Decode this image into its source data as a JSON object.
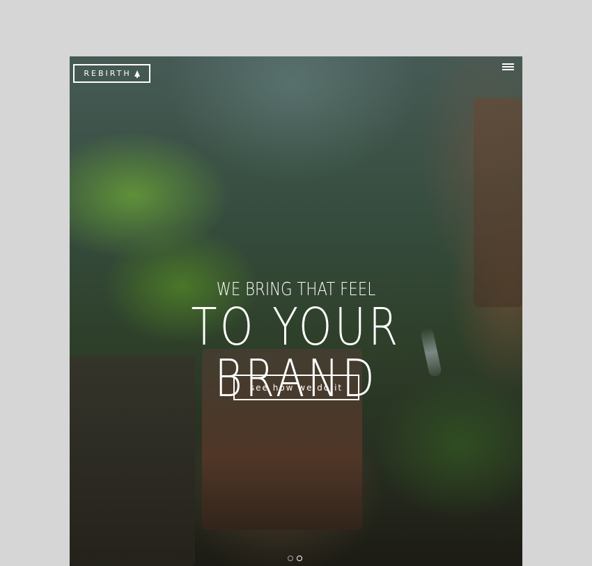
{
  "header": {
    "logo_text": "REBIRTH",
    "logo_icon": "tree-icon",
    "menu_icon": "hamburger-menu-icon"
  },
  "hero": {
    "tagline": "WE BRING THAT FEEL",
    "headline": "TO YOUR BRAND",
    "cta_label": "see how we do it"
  },
  "slider": {
    "slide_count": 2,
    "active_index": 1
  },
  "colors": {
    "page_background": "#d6d6d6",
    "foreground": "#ffffff"
  }
}
